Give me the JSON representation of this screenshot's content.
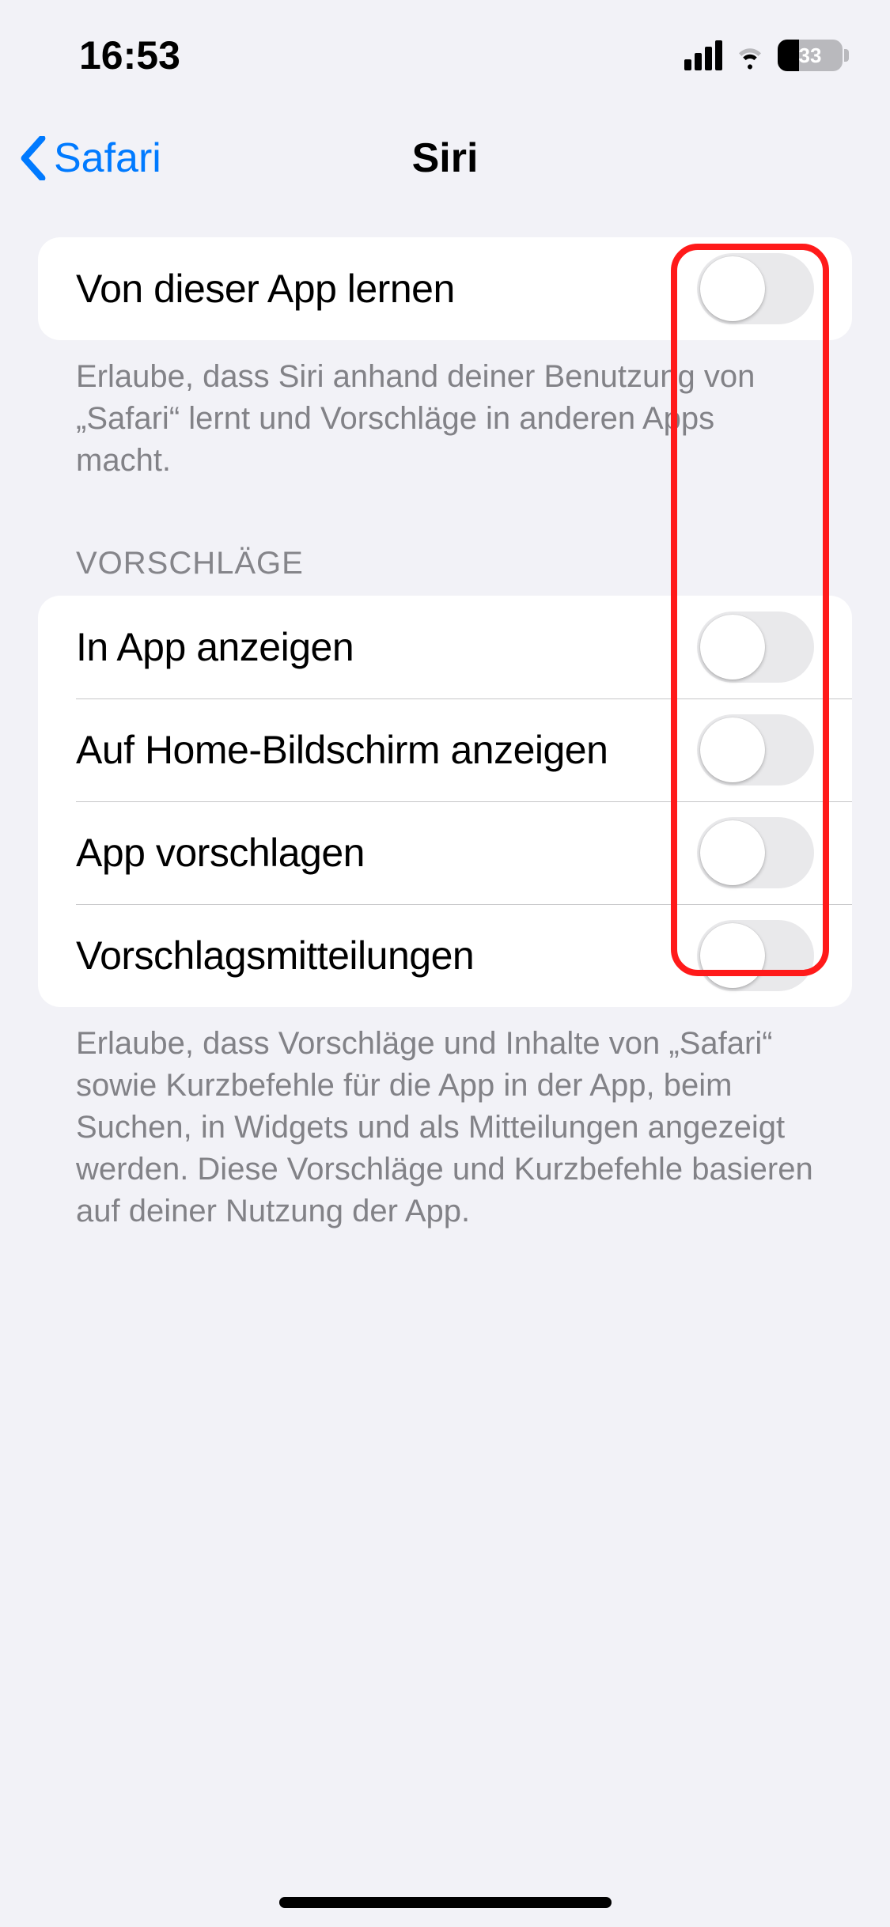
{
  "status": {
    "time": "16:53",
    "battery_percent": "33"
  },
  "nav": {
    "back_label": "Safari",
    "title": "Siri"
  },
  "section1": {
    "items": [
      {
        "label": "Von dieser App lernen"
      }
    ],
    "footer": "Erlaube, dass Siri anhand deiner Benutzung von „Safari“ lernt und Vorschläge in anderen Apps macht."
  },
  "section2": {
    "header": "VORSCHLÄGE",
    "items": [
      {
        "label": "In App anzeigen"
      },
      {
        "label": "Auf Home-Bildschirm anzeigen"
      },
      {
        "label": "App vorschlagen"
      },
      {
        "label": "Vorschlagsmitteilungen"
      }
    ],
    "footer": "Erlaube, dass Vorschläge und Inhalte von „Safari“ sowie Kurzbefehle für die App in der App, beim Suchen, in Widgets und als Mitteilungen angezeigt werden. Diese Vorschläge und Kurzbefehle basieren auf deiner Nutzung der App."
  }
}
